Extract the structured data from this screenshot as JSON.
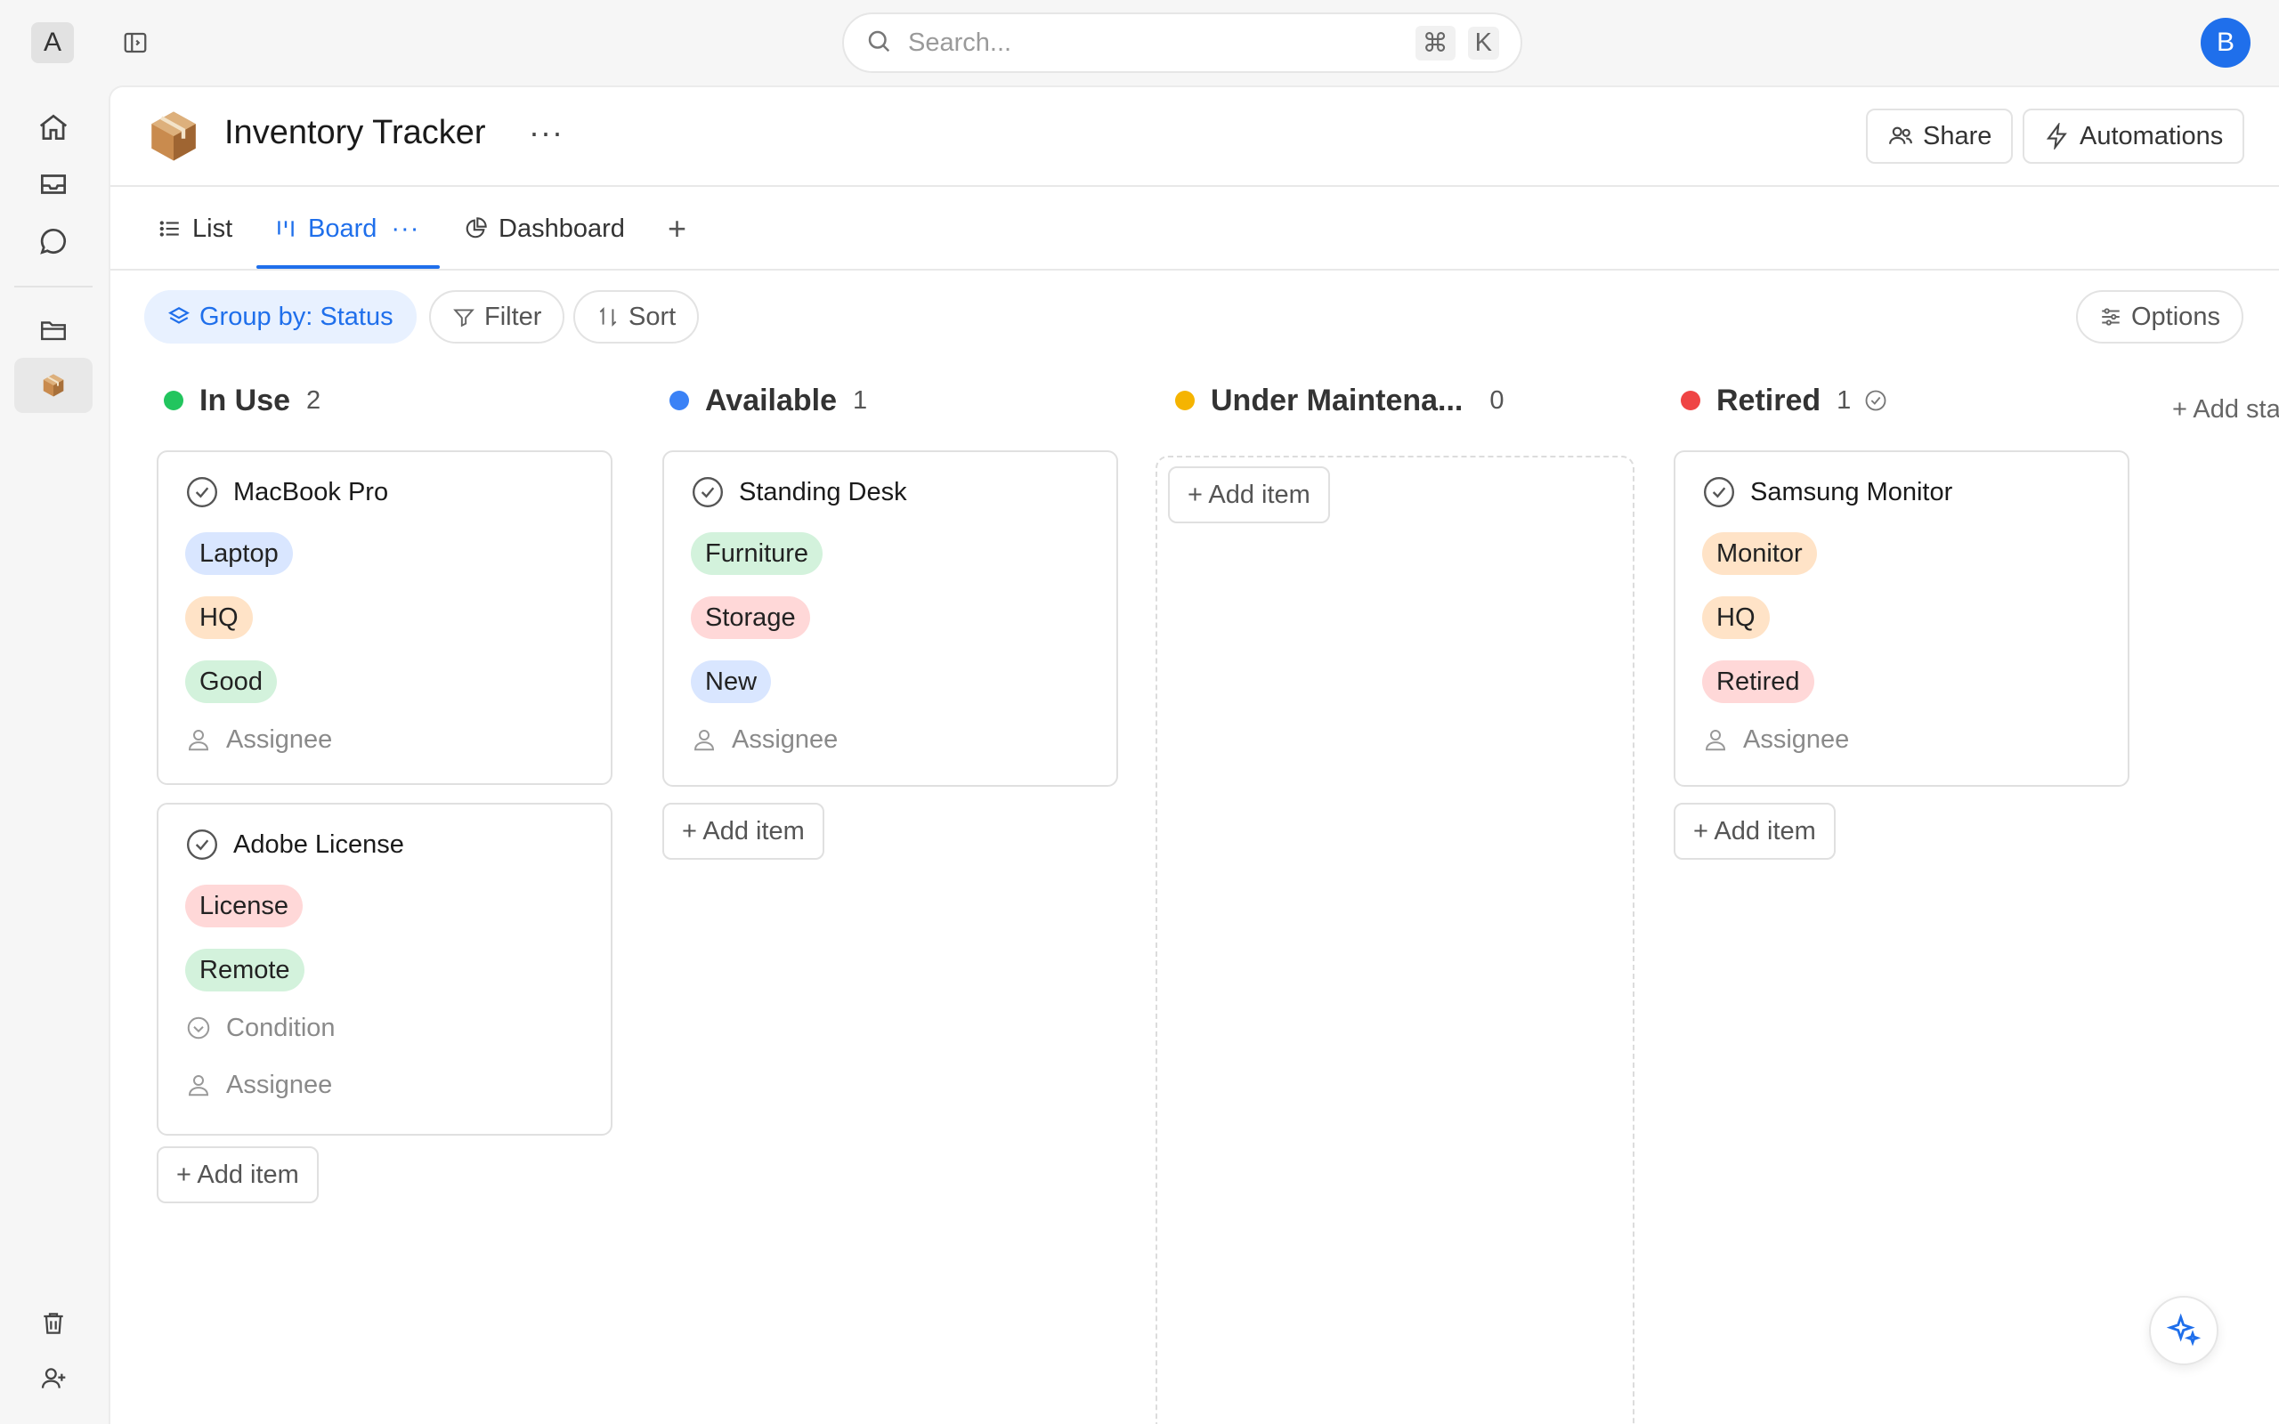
{
  "workspace": {
    "initial": "A"
  },
  "user": {
    "initial": "B"
  },
  "search": {
    "placeholder": "Search...",
    "shortcut_mod": "⌘",
    "shortcut_key": "K"
  },
  "rail": {
    "items": [
      "home-icon",
      "inbox-icon",
      "chat-icon",
      "folder-icon",
      "package-icon"
    ],
    "bottom": [
      "trash-icon",
      "add-user-icon"
    ]
  },
  "page": {
    "title": "Inventory Tracker",
    "more": "···"
  },
  "header_actions": {
    "share": "Share",
    "automations": "Automations"
  },
  "tabs": [
    {
      "label": "List"
    },
    {
      "label": "Board",
      "more": "···"
    },
    {
      "label": "Dashboard"
    },
    {
      "label": "+"
    }
  ],
  "toolbar": {
    "group_by": "Group by: Status",
    "filter": "Filter",
    "sort": "Sort",
    "options": "Options"
  },
  "board": {
    "add_status": "+ Add sta",
    "columns": [
      {
        "name": "In Use",
        "count": "2",
        "color": "#22c55e",
        "cards": [
          {
            "title": "MacBook Pro",
            "tags": [
              "Laptop",
              "HQ",
              "Good"
            ],
            "props": [
              "Assignee"
            ]
          },
          {
            "title": "Adobe License",
            "tags": [
              "License",
              "Remote"
            ],
            "props": [
              "Condition",
              "Assignee"
            ]
          }
        ],
        "add_item": "+ Add item"
      },
      {
        "name": "Available",
        "count": "1",
        "color": "#3b82f6",
        "cards": [
          {
            "title": "Standing Desk",
            "tags": [
              "Furniture",
              "Storage",
              "New"
            ],
            "props": [
              "Assignee"
            ]
          }
        ],
        "add_item": "+ Add item"
      },
      {
        "name": "Under Maintena...",
        "count": "0",
        "color": "#f5b400",
        "cards": [],
        "add_item": "+ Add item"
      },
      {
        "name": "Retired",
        "count": "1",
        "color": "#ef4444",
        "cards": [
          {
            "title": "Samsung Monitor",
            "tags": [
              "Monitor",
              "HQ",
              "Retired"
            ],
            "props": [
              "Assignee"
            ]
          }
        ],
        "add_item": "+ Add item"
      }
    ]
  },
  "tag_colors": {
    "blue": "#d9e6ff",
    "orange": "#ffe3c7",
    "green": "#d3f2dc",
    "red": "#ffd8d8"
  }
}
